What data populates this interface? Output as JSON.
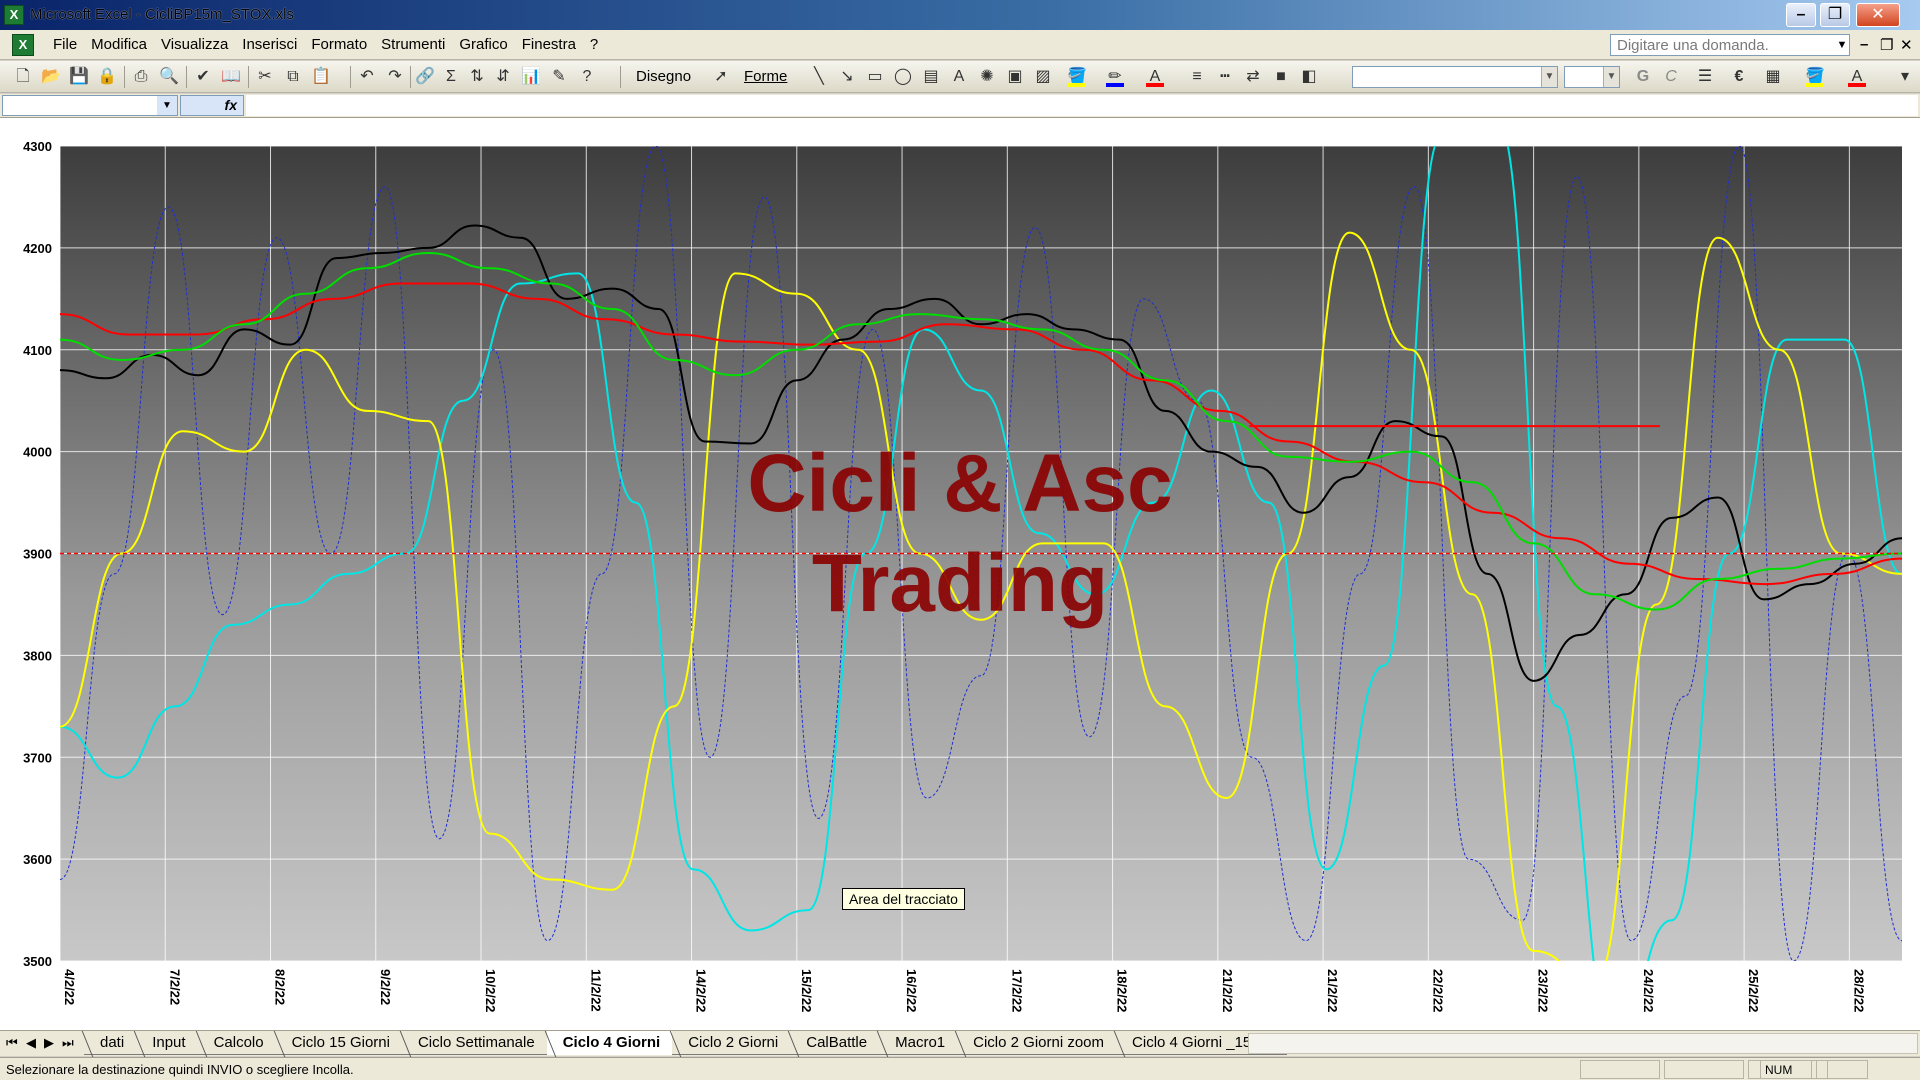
{
  "window": {
    "title": "Microsoft Excel - CicliBP15m_STOX.xls",
    "app_icon": "X"
  },
  "menu": {
    "items": [
      "File",
      "Modifica",
      "Visualizza",
      "Inserisci",
      "Formato",
      "Strumenti",
      "Grafico",
      "Finestra",
      "?"
    ],
    "ask_placeholder": "Digitare una domanda."
  },
  "toolbar": {
    "draw_label": "Disegno",
    "shapes_label": "Forme",
    "bold_label": "G",
    "italic_label": "C",
    "euro_label": "€",
    "sigma_label": "Σ",
    "icons": [
      "new-icon",
      "open-icon",
      "save-icon",
      "permission-icon",
      "print-icon",
      "print-preview-icon",
      "spelling-icon",
      "research-icon",
      "cut-icon",
      "copy-icon",
      "paste-icon",
      "undo-icon",
      "redo-icon",
      "chart-wizard-icon",
      "drawing-icon",
      "help-icon"
    ],
    "colors": {
      "fill": "#ffff00",
      "line": "#0000ff",
      "font": "#ff0000"
    }
  },
  "formula_bar": {
    "fx_label": "fx",
    "name_box": "",
    "value": ""
  },
  "chart_data": {
    "type": "line",
    "x": [
      "4/2/22",
      "7/2/22",
      "8/2/22",
      "9/2/22",
      "10/2/22",
      "11/2/22",
      "14/2/22",
      "15/2/22",
      "16/2/22",
      "17/2/22",
      "18/2/22",
      "21/2/22",
      "21/2/22",
      "22/2/22",
      "23/2/22",
      "24/2/22",
      "25/2/22",
      "28/2/22"
    ],
    "ylim": [
      3500,
      4300
    ],
    "yticks": [
      3500,
      3600,
      3700,
      3800,
      3900,
      4000,
      4100,
      4200,
      4300
    ],
    "grid": true,
    "watermark": [
      "Cicli & Asc",
      "Trading"
    ],
    "reference_lines": [
      {
        "value": 4025,
        "color": "#ff0000",
        "style": "solid",
        "x_from": 11.3,
        "x_to": 15.2
      },
      {
        "value": 3900,
        "color": "#ff0000",
        "style": "dashed"
      }
    ],
    "series": [
      {
        "color": "#000000",
        "width": 2,
        "values": [
          4080,
          4072,
          4095,
          4075,
          4120,
          4105,
          4190,
          4195,
          4200,
          4222,
          4210,
          4150,
          4160,
          4140,
          4010,
          4008,
          4070,
          4110,
          4140,
          4150,
          4125,
          4135,
          4120,
          4110,
          4040,
          4000,
          3985,
          3940,
          3975,
          4030,
          4015,
          3880,
          3775,
          3820,
          3860,
          3935,
          3955,
          3855,
          3870,
          3890,
          3915
        ]
      },
      {
        "color": "#00dd00",
        "width": 2,
        "values": [
          4110,
          4090,
          4100,
          4125,
          4155,
          4180,
          4195,
          4180,
          4165,
          4140,
          4090,
          4075,
          4100,
          4125,
          4135,
          4130,
          4120,
          4100,
          4070,
          4030,
          3995,
          3990,
          4000,
          3970,
          3910,
          3860,
          3845,
          3875,
          3885,
          3895,
          3900
        ]
      },
      {
        "color": "#ff0000",
        "width": 2,
        "values": [
          4135,
          4115,
          4115,
          4130,
          4150,
          4165,
          4165,
          4150,
          4130,
          4115,
          4108,
          4105,
          4108,
          4125,
          4120,
          4100,
          4070,
          4040,
          4010,
          3990,
          3970,
          3940,
          3915,
          3890,
          3875,
          3870,
          3880,
          3895
        ]
      },
      {
        "color": "#ffff00",
        "width": 2,
        "values": [
          3730,
          3900,
          4020,
          4000,
          4100,
          4040,
          4030,
          3625,
          3580,
          3570,
          3750,
          4175,
          4155,
          4100,
          3900,
          3835,
          3910,
          3910,
          3750,
          3660,
          3900,
          4215,
          4100,
          3860,
          3510,
          3480,
          3850,
          4210,
          4100,
          3900,
          3880
        ]
      },
      {
        "color": "#00e5e5",
        "width": 2,
        "values": [
          3730,
          3680,
          3750,
          3830,
          3850,
          3880,
          3900,
          4050,
          4165,
          4175,
          3950,
          3590,
          3530,
          3550,
          3900,
          4120,
          4060,
          3920,
          3860,
          3950,
          4060,
          3950,
          3590,
          3790,
          4310,
          4320,
          3750,
          3420,
          3540,
          3900,
          4110,
          4110,
          3880
        ]
      },
      {
        "color": "#1f2fd0",
        "width": 1,
        "dashed": true,
        "values": [
          3580,
          3880,
          4240,
          3840,
          4210,
          3900,
          4260,
          3620,
          4100,
          3520,
          3880,
          4300,
          3700,
          4250,
          3640,
          4120,
          3660,
          3780,
          4220,
          3720,
          4150,
          4050,
          3700,
          3520,
          3880,
          4260,
          3600,
          3540,
          4270,
          3520,
          3760,
          4300,
          3500,
          3900,
          3520
        ]
      }
    ]
  },
  "tooltip": "Area del tracciato",
  "sheet_tabs": {
    "tabs": [
      "dati",
      "Input",
      "Calcolo",
      "Ciclo 15 Giorni",
      "Ciclo Settimanale",
      "Ciclo 4 Giorni",
      "Ciclo 2 Giorni",
      "CalBattle",
      "Macro1",
      "Ciclo 2 Giorni zoom",
      "Ciclo 4 Giorni _15GG"
    ],
    "active_index": 5
  },
  "status": {
    "message": "Selezionare la destinazione quindi INVIO o scegliere Incolla.",
    "num": "NUM"
  }
}
